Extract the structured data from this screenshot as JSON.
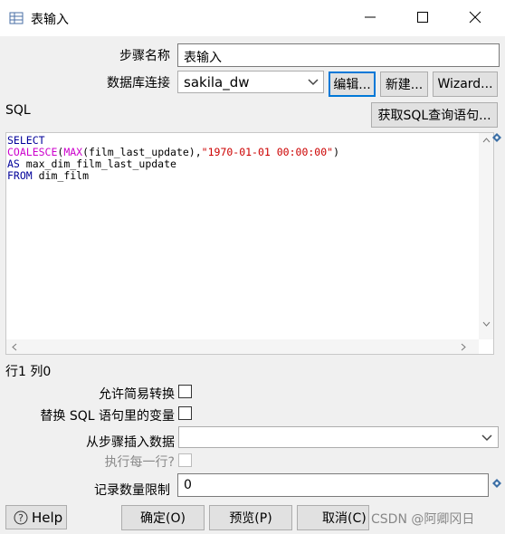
{
  "window": {
    "title": "表输入",
    "icon": "table-input-icon"
  },
  "form": {
    "step_name_label": "步骤名称",
    "step_name_value": "表输入",
    "db_connection_label": "数据库连接",
    "db_connection_value": "sakila_dw",
    "edit_button": "编辑...",
    "new_button": "新建...",
    "wizard_button": "Wizard...",
    "sql_label": "SQL",
    "get_sql_button": "获取SQL查询语句...",
    "sql_lines": [
      "SELECT",
      "COALESCE(MAX(film_last_update),\"1970-01-01 00:00:00\")",
      "AS max_dim_film_last_update",
      "FROM dim_film"
    ],
    "cursor_position": "行1 列0",
    "lazy_conversion_label": "允许简易转换",
    "replace_vars_label": "替换 SQL 语句里的变量",
    "insert_from_step_label": "从步骤插入数据",
    "execute_each_row_label": "执行每一行?",
    "limit_label": "记录数量限制",
    "limit_value": "0"
  },
  "buttons": {
    "help": "Help",
    "ok": "确定(O)",
    "preview": "预览(P)",
    "cancel": "取消(C)"
  },
  "watermark": "CSDN @阿卿冈日",
  "colors": {
    "accent": "#0078d7",
    "keyword": "#000099",
    "function": "#cc00cc",
    "string": "#cc0000"
  }
}
